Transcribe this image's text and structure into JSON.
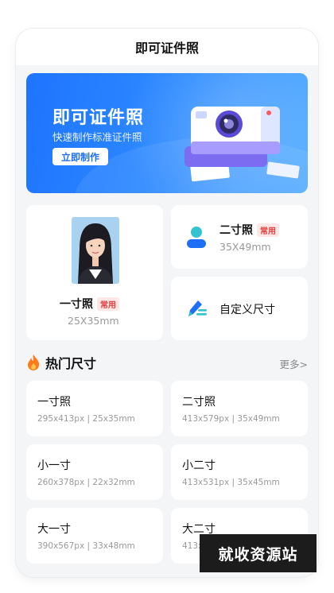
{
  "header": {
    "title": "即可证件照"
  },
  "banner": {
    "title": "即可证件照",
    "subtitle": "快速制作标准证件照",
    "button_label": "立即制作",
    "colors": {
      "start": "#1e74ff",
      "end": "#56adff"
    }
  },
  "cards": {
    "one_inch": {
      "name": "一寸照",
      "tag": "常用",
      "dims": "25X35mm"
    },
    "two_inch": {
      "name": "二寸照",
      "tag": "常用",
      "dims": "35X49mm"
    },
    "custom": {
      "name": "自定义尺寸"
    }
  },
  "hot": {
    "title": "热门尺寸",
    "more_label": "更多>",
    "items": [
      {
        "name": "一寸照",
        "spec": "295x413px | 25x35mm"
      },
      {
        "name": "二寸照",
        "spec": "413x579px | 35x49mm"
      },
      {
        "name": "小一寸",
        "spec": "260x378px | 22x32mm"
      },
      {
        "name": "小二寸",
        "spec": "413x531px | 35x45mm"
      },
      {
        "name": "大一寸",
        "spec": "390x567px | 33x48mm"
      },
      {
        "name": "大二寸",
        "spec": "413x"
      }
    ]
  },
  "watermark": {
    "text": "就收资源站"
  },
  "icons": {
    "person": "person-icon",
    "pen": "pen-icon",
    "fire": "fire-icon",
    "camera": "camera-illustration"
  },
  "colors": {
    "accent": "#1e6ff6",
    "tag_red": "#e33c3c",
    "fire": "#ff7a1a"
  }
}
